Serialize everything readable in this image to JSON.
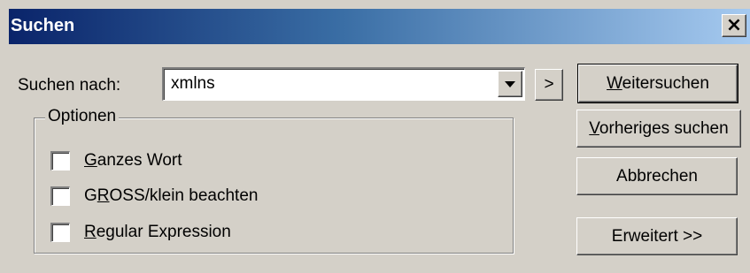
{
  "window": {
    "title": "Suchen",
    "close_glyph": "×"
  },
  "find": {
    "label": "Suchen nach:",
    "value": "xmlns",
    "expand_label": ">"
  },
  "options": {
    "legend": "Optionen",
    "items": [
      {
        "pre": "",
        "mnemonic": "G",
        "post": "anzes Wort",
        "checked": false
      },
      {
        "pre": "G",
        "mnemonic": "R",
        "post": "OSS/klein beachten",
        "checked": false
      },
      {
        "pre": "",
        "mnemonic": "R",
        "post": "egular Expression",
        "checked": false
      }
    ]
  },
  "buttons": {
    "next": {
      "pre": "",
      "mnemonic": "W",
      "post": "eitersuchen"
    },
    "prev": {
      "pre": "",
      "mnemonic": "V",
      "post": "orheriges suchen"
    },
    "cancel": "Abbrechen",
    "advanced": "Erweitert >>"
  },
  "colors": {
    "face": "#d4d0c8",
    "title_start": "#0a246a",
    "title_end": "#a6caf0"
  }
}
